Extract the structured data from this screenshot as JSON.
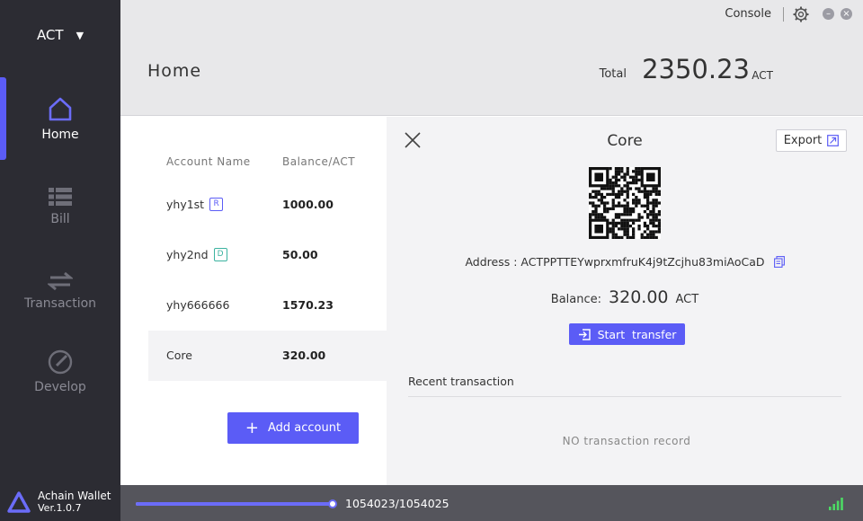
{
  "sidebar": {
    "asset": "ACT",
    "items": [
      {
        "label": "Home",
        "icon": "home-icon",
        "active": true
      },
      {
        "label": "Bill",
        "icon": "bill-icon",
        "active": false
      },
      {
        "label": "Transaction",
        "icon": "transaction-icon",
        "active": false
      },
      {
        "label": "Develop",
        "icon": "develop-icon",
        "active": false
      }
    ],
    "brand_name": "Achain Wallet",
    "version": "Ver.1.0.7"
  },
  "header": {
    "console": "Console",
    "title": "Home",
    "total_label": "Total",
    "total_value": "2350.23",
    "total_unit": "ACT"
  },
  "accounts": {
    "col_name": "Account Name",
    "col_balance": "Balance/ACT",
    "rows": [
      {
        "name": "yhy1st",
        "badge": "R",
        "balance": "1000.00"
      },
      {
        "name": "yhy2nd",
        "badge": "D",
        "balance": "50.00"
      },
      {
        "name": "yhy666666",
        "badge": "",
        "balance": "1570.23"
      },
      {
        "name": "Core",
        "badge": "",
        "balance": "320.00"
      }
    ],
    "add_label": "Add account"
  },
  "detail": {
    "title": "Core",
    "export": "Export",
    "address_label": "Address :",
    "address": "ACTPPTTEYwprxmfruK4j9tZcjhu83miAoCaD",
    "balance_label": "Balance:",
    "balance_value": "320.00",
    "balance_unit": "ACT",
    "transfer": "Start  transfer",
    "recent_title": "Recent transaction",
    "empty": "NO transaction record"
  },
  "status": {
    "sync_text": "1054023/1054025",
    "sync_progress": 0.999998
  },
  "colors": {
    "accent": "#5b5cf6",
    "sidebar": "#2c2c33",
    "statusbar": "#55555c",
    "signal": "#4cd964"
  }
}
